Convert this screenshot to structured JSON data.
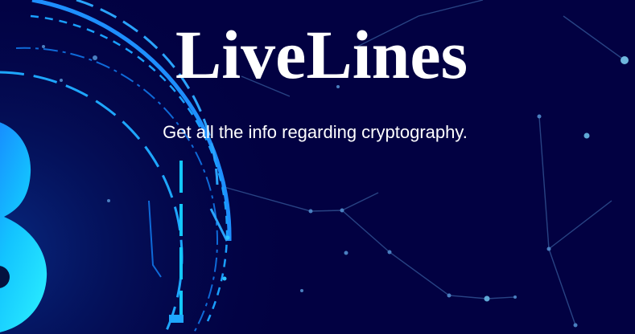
{
  "hero": {
    "title": "LiveLines",
    "subtitle": "Get all the info regarding cryptography."
  },
  "colors": {
    "background": "#020142",
    "accent_blue": "#1ea7ff",
    "accent_cyan": "#22e0ff",
    "network_lines": "#2f4f8f",
    "text": "#ffffff"
  },
  "icons": {
    "background_art": "crypto-network-rings-illustration"
  }
}
